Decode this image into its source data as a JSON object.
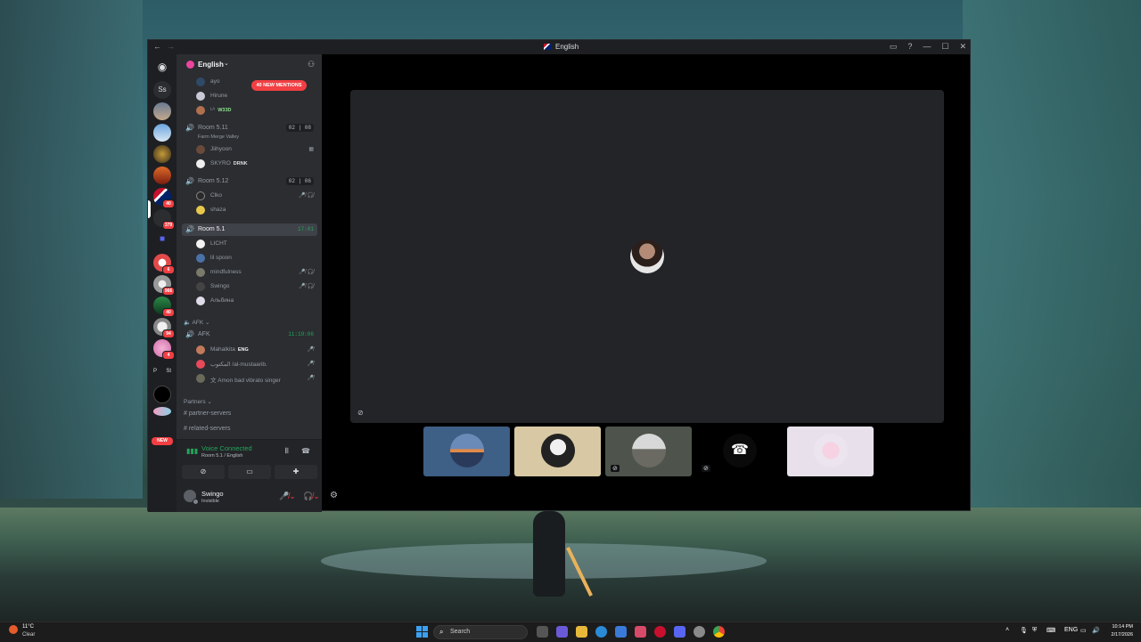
{
  "window": {
    "title": "English",
    "nav_back": "←",
    "nav_forward": "→",
    "controls": [
      "▭",
      "?",
      "—",
      "☐",
      "✕"
    ]
  },
  "rail": {
    "home_icon": "discord-icon",
    "ss_label": "Ss",
    "badges": [
      "40",
      "379",
      "6",
      "966",
      "40",
      "94",
      "4"
    ],
    "p_label": "P",
    "st_label": "St",
    "new_label": "NEW"
  },
  "guild": {
    "name": "English",
    "chevron": "⌄",
    "mentions": "40 NEW MENTIONS"
  },
  "top_users": [
    {
      "name": "ayo",
      "tag": ""
    },
    {
      "name": "Hirune",
      "tag": ""
    },
    {
      "name": "ᴸᴬ",
      "tag": "W33D"
    }
  ],
  "channels": [
    {
      "name": "Room 5.11",
      "subtitle": "Farm Merge Valley",
      "count": "02 | 08",
      "users": [
        {
          "name": "Jiihyoon",
          "tag": "",
          "icons": ""
        },
        {
          "name": "SKYRO",
          "tag": "DRNK",
          "icons": ""
        }
      ]
    },
    {
      "name": "Room 5.12",
      "subtitle": "",
      "count": "02 | 06",
      "users": [
        {
          "name": "Clko",
          "tag": "",
          "icons": "🎤̸ 🎧̸"
        },
        {
          "name": "shaza",
          "tag": "",
          "icons": ""
        }
      ]
    },
    {
      "name": "Room 5.1",
      "subtitle": "",
      "time": "17:01",
      "users": [
        {
          "name": "LICHT",
          "tag": "",
          "icons": ""
        },
        {
          "name": "lil spoon",
          "tag": "",
          "icons": ""
        },
        {
          "name": "mindfulness",
          "tag": "",
          "icons": "🎤̸ 🎧̸"
        },
        {
          "name": "Swingo",
          "tag": "",
          "icons": "🎤̸ 🎧̸"
        },
        {
          "name": "Альбина",
          "tag": "",
          "icons": ""
        }
      ]
    }
  ],
  "afk_category": "AFK",
  "afk_channel": {
    "name": "AFK",
    "time": "11:19:06",
    "users": [
      {
        "name": "Mahalkita",
        "tag": "ENG",
        "icons": "🎤̸"
      },
      {
        "name": "المكتوب /al-mustaarib.",
        "tag": "",
        "icons": "🎤̸"
      },
      {
        "name": "文 Amon bad vibrato singer",
        "tag": "",
        "icons": "🎤̸"
      }
    ]
  },
  "partners": {
    "label": "Partners",
    "channels": [
      "partner-servers",
      "related-servers"
    ]
  },
  "voice": {
    "status": "Voice Connected",
    "location": "Room 5.1 / English"
  },
  "user": {
    "name": "Swingo",
    "status": "Invisible"
  },
  "taskbar": {
    "temperature": "11°C",
    "condition": "Clear",
    "search_placeholder": "Search",
    "language": "ENG",
    "time": "10:14 PM",
    "date": "2/17/2026"
  },
  "colors": {
    "accent_green": "#23a55a",
    "mention_red": "#f23f43",
    "sidebar_bg": "#2b2d31",
    "rail_bg": "#1e1f22"
  }
}
